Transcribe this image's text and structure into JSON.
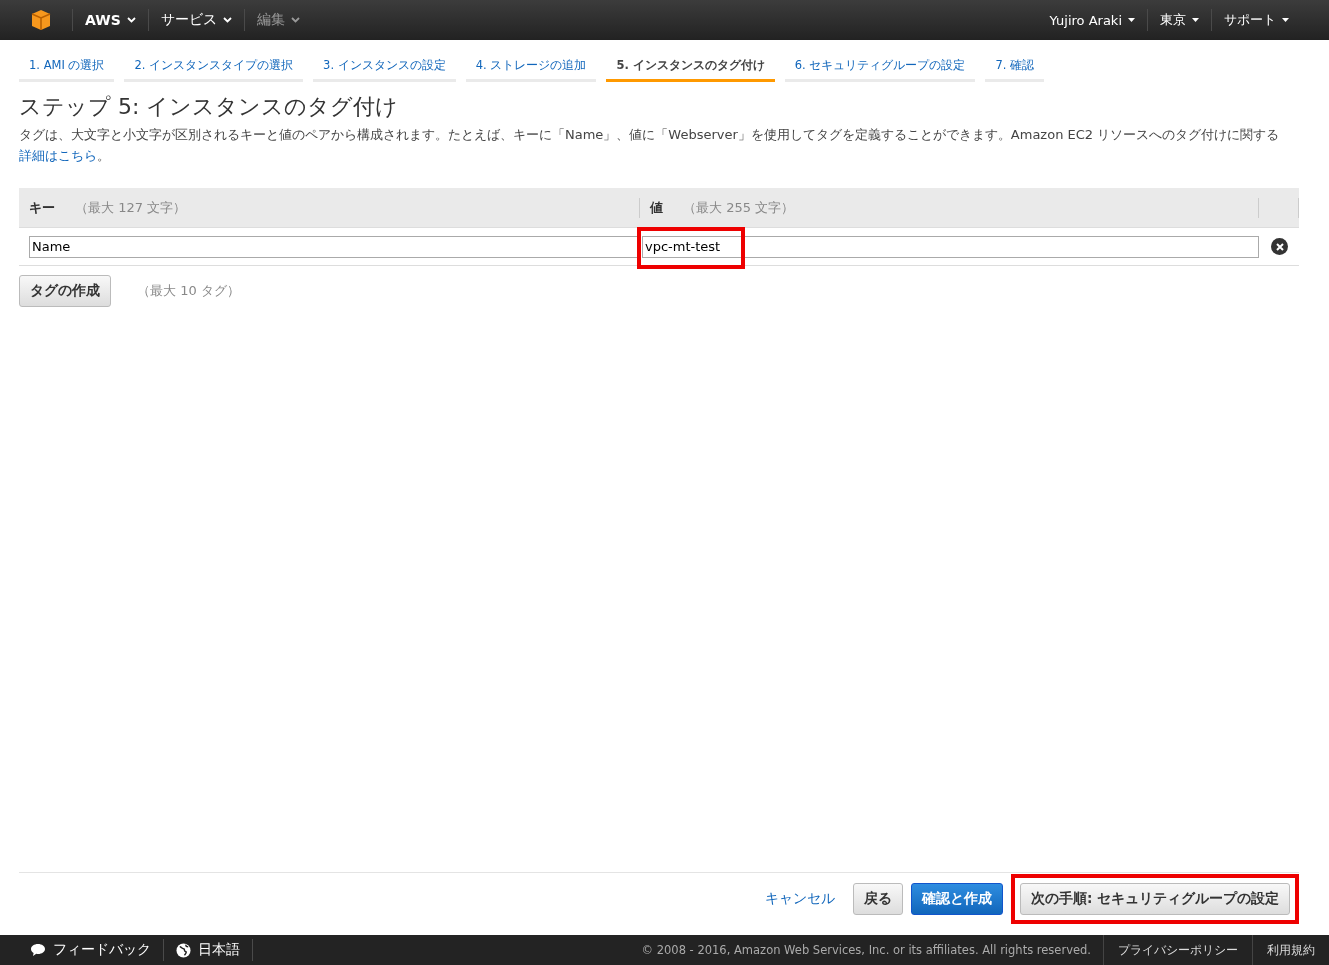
{
  "top_nav": {
    "menus": [
      {
        "label": "AWS",
        "disabled": false
      },
      {
        "label": "サービス",
        "disabled": false
      },
      {
        "label": "編集",
        "disabled": true
      }
    ],
    "right_menus": [
      "Yujiro Araki",
      "東京",
      "サポート"
    ]
  },
  "steps": [
    {
      "label": "1. AMI の選択",
      "selected": false
    },
    {
      "label": "2. インスタンスタイプの選択",
      "selected": false
    },
    {
      "label": "3. インスタンスの設定",
      "selected": false
    },
    {
      "label": "4. ストレージの追加",
      "selected": false
    },
    {
      "label": "5. インスタンスのタグ付け",
      "selected": true
    },
    {
      "label": "6. セキュリティグループの設定",
      "selected": false
    },
    {
      "label": "7. 確認",
      "selected": false
    }
  ],
  "title": "ステップ 5: インスタンスのタグ付け",
  "description": "タグは、大文字と小文字が区別されるキーと値のペアから構成されます。たとえば、キーに「Name」、値に「Webserver」を使用してタグを定義することができます。Amazon EC2 リソースへのタグ付けに関する ",
  "description_link": "詳細はこちら",
  "description_end": "。",
  "table": {
    "columns": [
      {
        "label": "キー",
        "hint": "（最大 127 文字）"
      },
      {
        "label": "値",
        "hint": "（最大 255 文字）"
      }
    ],
    "rows": [
      {
        "key": "Name",
        "value": "vpc-mt-test",
        "value_highlighted": true
      }
    ]
  },
  "add_tag_button": "タグの作成",
  "add_tag_hint": "（最大 10 タグ）",
  "actions": [
    {
      "kind": "link",
      "label": "キャンセル",
      "highlighted": false
    },
    {
      "kind": "default",
      "label": "戻る",
      "highlighted": false
    },
    {
      "kind": "primary",
      "label": "確認と作成",
      "highlighted": false
    },
    {
      "kind": "default",
      "label": "次の手順: セキュリティグループの設定",
      "highlighted": true
    }
  ],
  "footer": {
    "feedback": "フィードバック",
    "language": "日本語",
    "copyright": "© 2008 - 2016, Amazon Web Services, Inc. or its affiliates. All rights reserved.",
    "links": [
      "プライバシーポリシー",
      "利用規約"
    ]
  }
}
